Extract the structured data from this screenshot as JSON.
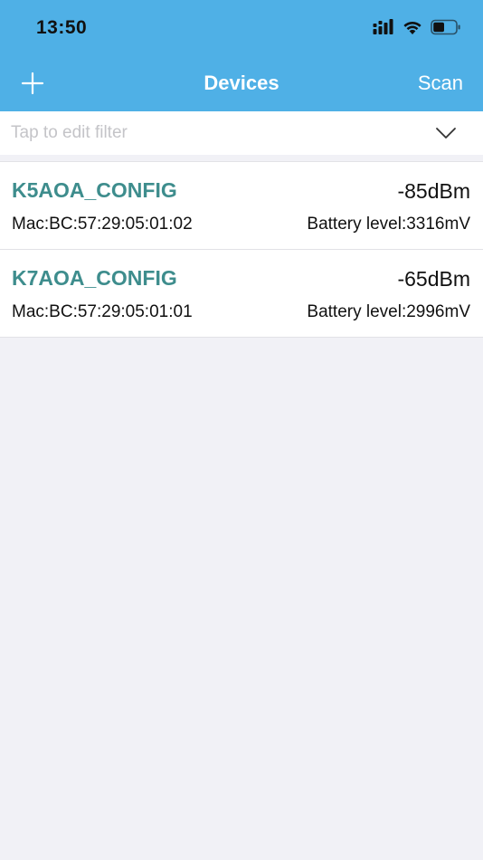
{
  "status_bar": {
    "time": "13:50",
    "icons": [
      "cellular-signal-icon",
      "wifi-icon",
      "battery-icon"
    ],
    "battery_fill": 0.5
  },
  "nav": {
    "title": "Devices",
    "add_icon": "plus-icon",
    "scan_label": "Scan"
  },
  "filter": {
    "placeholder": "Tap to edit filter",
    "value": "",
    "chevron_icon": "chevron-down-icon"
  },
  "devices": [
    {
      "name": "K5AOA_CONFIG",
      "rssi": "-85dBm",
      "mac": "Mac:BC:57:29:05:01:02",
      "battery": "Battery level:3316mV"
    },
    {
      "name": "K7AOA_CONFIG",
      "rssi": "-65dBm",
      "mac": "Mac:BC:57:29:05:01:01",
      "battery": "Battery level:2996mV"
    }
  ],
  "colors": {
    "header": "#4fb0e6",
    "device_name": "#3e8d8d",
    "background": "#f1f1f6"
  }
}
